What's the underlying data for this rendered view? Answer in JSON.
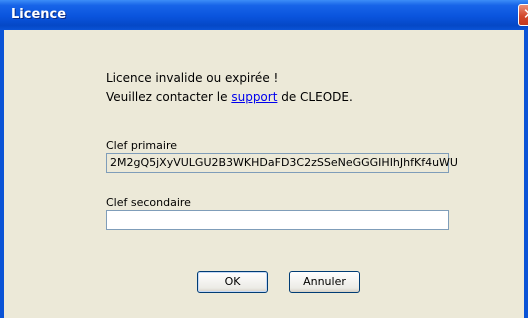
{
  "window": {
    "title": "Licence",
    "close_symbol": "✕"
  },
  "message": {
    "line1": "Licence invalide ou expirée !",
    "line2_prefix": "Veuillez contacter le ",
    "line2_link": "support",
    "line2_suffix": " de CLEODE."
  },
  "primary_key": {
    "label": "Clef primaire",
    "value": "2M2gQ5jXyVULGU2B3WKHDaFD3C2zSSeNeGGGIHIhJhfKf4uWU"
  },
  "secondary_key": {
    "label": "Clef secondaire",
    "value": ""
  },
  "buttons": {
    "ok": "OK",
    "cancel": "Annuler"
  },
  "colors": {
    "titlebar": "#0a54dd",
    "background": "#ece9d8",
    "close": "#d3482d",
    "link": "#0000ee"
  }
}
